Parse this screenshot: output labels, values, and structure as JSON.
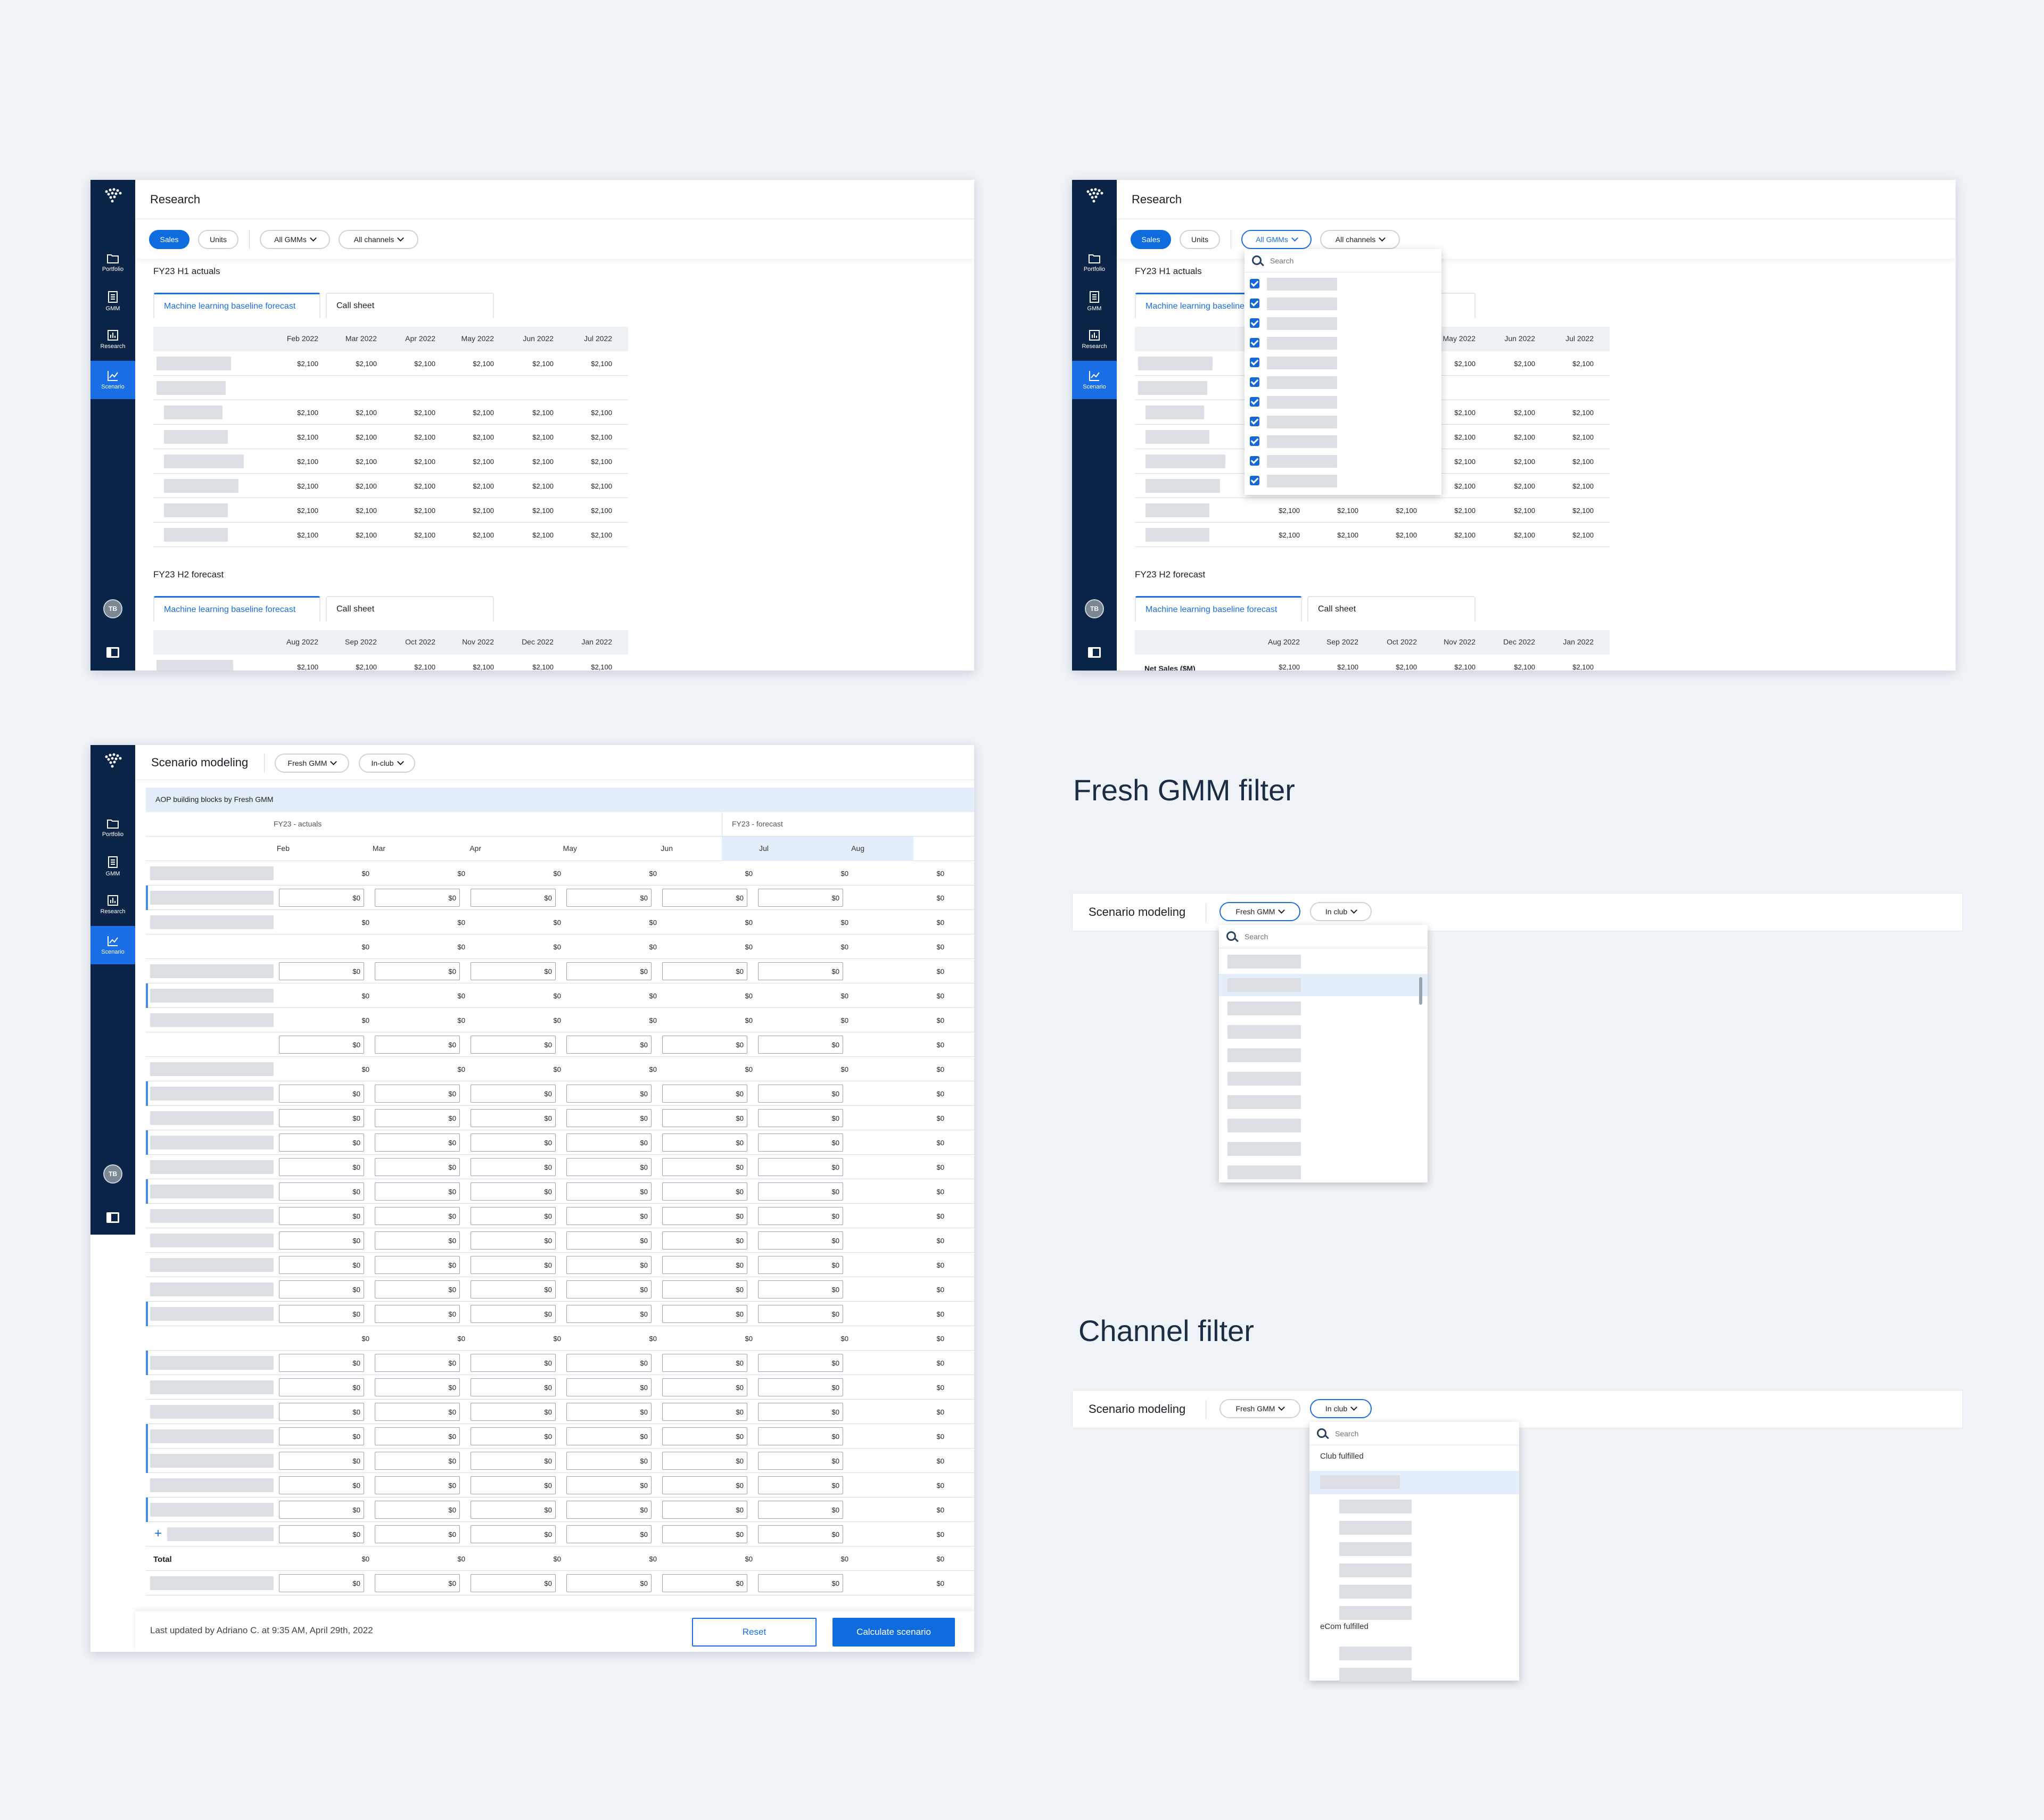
{
  "colors": {
    "rail": "#0a2447",
    "primary": "#0f6cde",
    "bg": "#eff3f7"
  },
  "nav": [
    {
      "label": "Portfolio",
      "icon": "folder-icon"
    },
    {
      "label": "GMM",
      "icon": "document-icon"
    },
    {
      "label": "Research",
      "icon": "bar-chart-icon"
    },
    {
      "label": "Scenario",
      "icon": "line-chart-icon"
    }
  ],
  "avatar": "TB",
  "research": {
    "title": "Research",
    "sales": "Sales",
    "units": "Units",
    "gmms": "All GMMs",
    "channels": "All channels",
    "h1": "FY23 H1 actuals",
    "h2": "FY23 H2 forecast",
    "tab_ml": "Machine learning baseline forecast",
    "tab_call": "Call sheet",
    "h1_months": [
      "Feb 2022",
      "Mar 2022",
      "Apr 2022",
      "May 2022",
      "Jun 2022",
      "Jul 2022"
    ],
    "h2_months": [
      "Aug 2022",
      "Sep 2022",
      "Oct 2022",
      "Nov 2022",
      "Dec 2022",
      "Jan 2022"
    ],
    "cell": "$2,100",
    "net_sales": "Net Sales ($M)",
    "search": "Search"
  },
  "scenario": {
    "title": "Scenario modeling",
    "gmm": "Fresh GMM",
    "channel": "In-club",
    "channel2": "In club",
    "banner": "AOP building blocks by Fresh GMM",
    "grp_actuals": "FY23 - actuals",
    "grp_forecast": "FY23 - forecast",
    "months": [
      "Feb",
      "Mar",
      "Apr",
      "May",
      "Jun",
      "Jul",
      "Aug"
    ],
    "cell": "$0",
    "total": "Total",
    "add": "+",
    "updated": "Last updated by Adriano C. at 9:35 AM, April 29th, 2022",
    "reset": "Reset",
    "calc": "Calculate scenario"
  },
  "fresh_filter": {
    "heading": "Fresh GMM filter",
    "search": "Search"
  },
  "channel_filter": {
    "heading": "Channel filter",
    "search": "Search",
    "club": "Club fulfilled",
    "ecom": "eCom fulfilled"
  }
}
